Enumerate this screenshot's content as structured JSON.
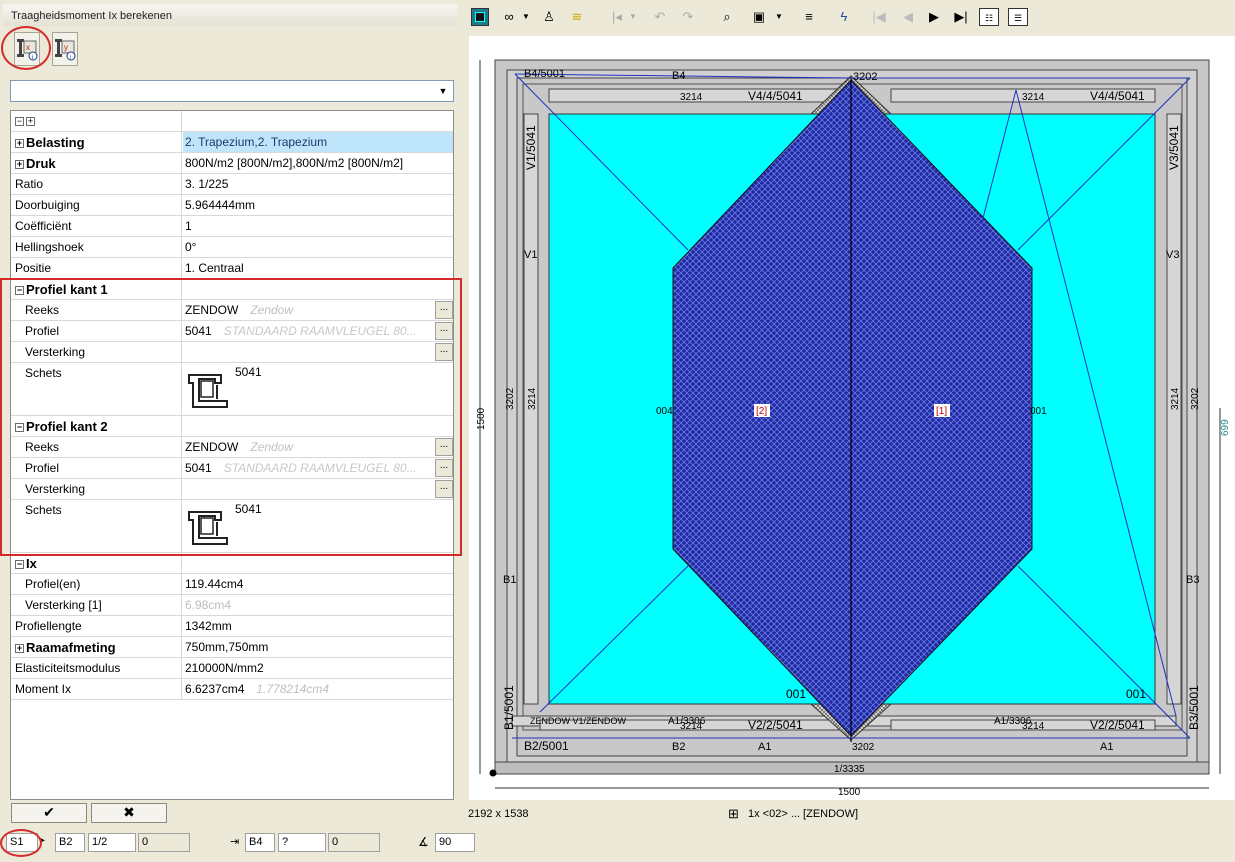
{
  "title": "Traagheidsmoment Ix berekenen",
  "tools": {
    "ix_label": "Ix",
    "iy_label": "Iy"
  },
  "grid": {
    "belasting": {
      "label": "Belasting",
      "value": "2. Trapezium,2. Trapezium"
    },
    "druk": {
      "label": "Druk",
      "value": "800N/m2 [800N/m2],800N/m2 [800N/m2]"
    },
    "ratio": {
      "label": "Ratio",
      "value": "3. 1/225"
    },
    "doorbuiging": {
      "label": "Doorbuiging",
      "value": "5.964444mm"
    },
    "coefficient": {
      "label": "Coëfficiënt",
      "value": "1"
    },
    "hellingshoek": {
      "label": "Hellingshoek",
      "value": "0°"
    },
    "positie": {
      "label": "Positie",
      "value": "1. Centraal"
    },
    "profiel1": {
      "header": "Profiel kant 1",
      "reeks_label": "Reeks",
      "reeks_value": "ZENDOW",
      "reeks_hint": "Zendow",
      "profiel_label": "Profiel",
      "profiel_value": "5041",
      "profiel_hint": "STANDAARD RAAMVLEUGEL 80...",
      "versterking_label": "Versterking",
      "schets_label": "Schets",
      "schets_value": "5041"
    },
    "profiel2": {
      "header": "Profiel kant 2",
      "reeks_label": "Reeks",
      "reeks_value": "ZENDOW",
      "reeks_hint": "Zendow",
      "profiel_label": "Profiel",
      "profiel_value": "5041",
      "profiel_hint": "STANDAARD RAAMVLEUGEL 80...",
      "versterking_label": "Versterking",
      "schets_label": "Schets",
      "schets_value": "5041"
    },
    "ix": {
      "header": "Ix",
      "profielen_label": "Profiel(en)",
      "profielen_value": "119.44cm4",
      "versterking_label": "Versterking [1]",
      "versterking_value": "6.98cm4"
    },
    "profiellengte": {
      "label": "Profiellengte",
      "value": "1342mm"
    },
    "raamafmeting": {
      "label": "Raamafmeting",
      "value": "750mm,750mm"
    },
    "elasticiteit": {
      "label": "Elasticiteitsmodulus",
      "value": "210000N/mm2"
    },
    "moment": {
      "label": "Moment Ix",
      "value": "6.6237cm4",
      "hint": "1.778214cm4"
    }
  },
  "buttons": {
    "ok": "✔",
    "cancel": "✖"
  },
  "drawing": {
    "labels": {
      "b4_left": "B4/5001",
      "b4": "B4",
      "top_code": "3202",
      "v4_left_code": "3214",
      "v4_left": "V4/4/5041",
      "v4_right_code": "3214",
      "v4_right": "V4/4/5041",
      "v1": "V1/5041",
      "v1s": "V1",
      "v3": "V3/5041",
      "v3s": "V3",
      "left_3202": "3202",
      "left_3214": "3214",
      "right_3214": "3214",
      "right_3202": "3202",
      "n004": "004",
      "n001": "001",
      "panel2": "[2]",
      "panel1": "[1]",
      "b1": "B1",
      "b3": "B3",
      "b1_5001": "B1/5001",
      "b3_5001": "B3/5001",
      "c001_left": "001",
      "c001_right": "001",
      "a1_3306_left": "A1/3306",
      "a1_3306_right": "A1/3306",
      "zendow_strip": "ZENDOW V1/ZENDOW",
      "v2_left_code": "3214",
      "v2_left": "V2/2/5041",
      "v2_right_code": "3214",
      "v2_right": "V2/2/5041",
      "b2_left": "B2/5001",
      "b2": "B2",
      "a1_left": "A1",
      "bottom_code": "3202",
      "a1_right": "A1",
      "bottom_sill": "1/3335",
      "width_dim": "1500",
      "height_dim": "1500",
      "right_dim": "699"
    }
  },
  "status": {
    "size": "2192 x 1538",
    "info": "1x <02> ... [ZENDOW]"
  },
  "bottom": {
    "s1": "S1",
    "b2": "B2",
    "half": "1/2",
    "zero1": "0",
    "b4": "B4",
    "q": "?",
    "zero2": "0",
    "angle": "90"
  }
}
